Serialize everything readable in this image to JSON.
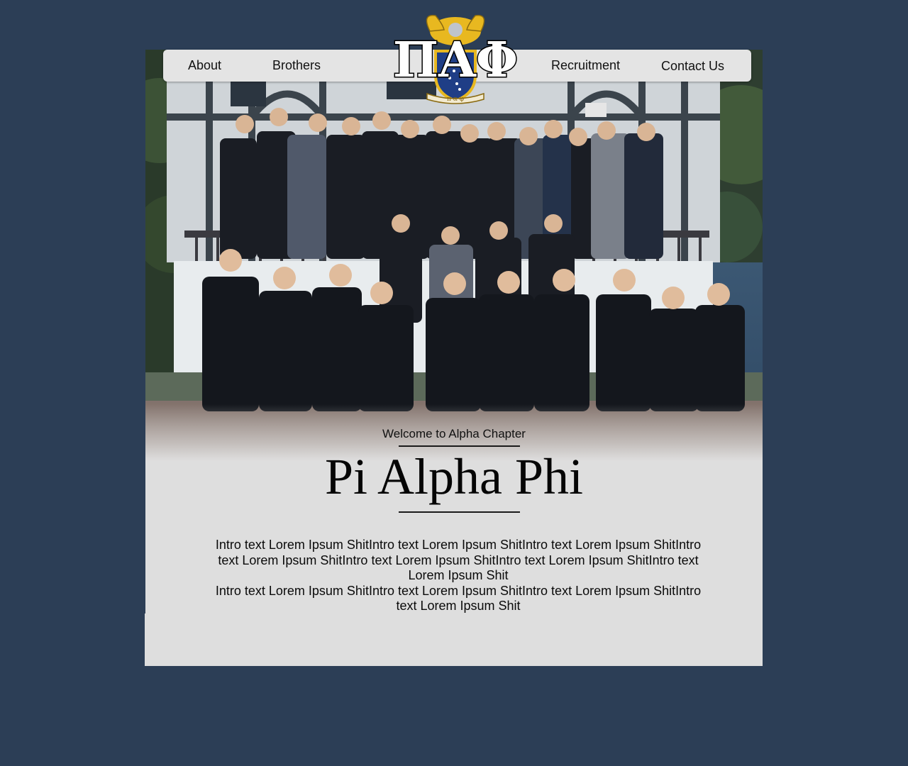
{
  "nav": {
    "about": "About",
    "brothers": "Brothers",
    "recruitment": "Recruitment",
    "contact": "Contact Us"
  },
  "logo": {
    "letters": "ΠΑΦ",
    "motto": "π α φ"
  },
  "hero": {
    "welcome": "Welcome to Alpha Chapter",
    "title": "Pi Alpha Phi"
  },
  "intro": {
    "paragraph_1": "Intro text Lorem Ipsum ShitIntro text Lorem Ipsum ShitIntro text Lorem Ipsum ShitIntro text Lorem Ipsum ShitIntro text Lorem Ipsum ShitIntro text Lorem Ipsum ShitIntro text Lorem Ipsum Shit",
    "paragraph_2": "Intro text Lorem Ipsum ShitIntro text Lorem Ipsum ShitIntro text Lorem Ipsum ShitIntro text Lorem Ipsum Shit"
  },
  "colors": {
    "background": "#2c3e56",
    "card": "#dedede",
    "crest_gold": "#e8b820",
    "crest_blue": "#1f3e86"
  }
}
